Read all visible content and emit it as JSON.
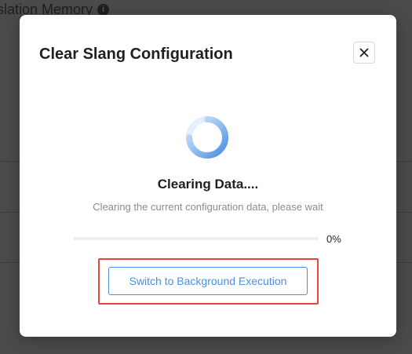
{
  "background": {
    "title": "slation Memory",
    "info_icon": "info-icon"
  },
  "modal": {
    "title": "Clear Slang Configuration",
    "close_icon": "close-icon",
    "status_title": "Clearing Data....",
    "status_description": "Clearing the current configuration data, please wait",
    "progress": {
      "value": 0,
      "label": "0%"
    },
    "background_button_label": "Switch to Background Execution"
  },
  "colors": {
    "accent": "#4a90e2",
    "highlight": "#e0483e",
    "overlay": "#4a4a4a"
  }
}
